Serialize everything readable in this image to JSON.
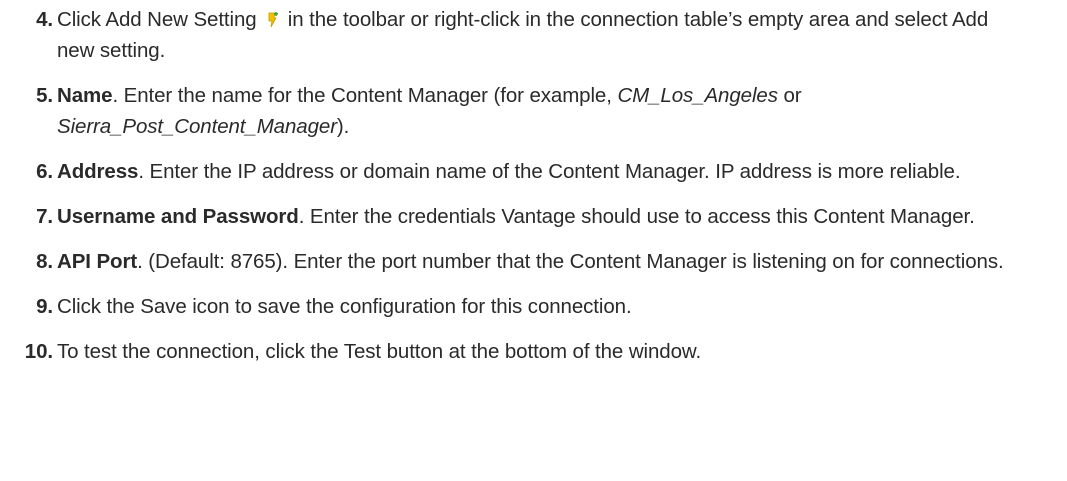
{
  "steps": [
    {
      "number": "4.",
      "text_before": "Click Add New Setting",
      "icon": "add-new-setting-icon",
      "text_after": "in the toolbar or right-click in the connection table’s empty area and select Add new setting."
    },
    {
      "number": "5.",
      "term": "Name",
      "text": ". Enter the name for the Content Manager (for example, ",
      "example_1": "CM_Los_Angeles",
      "joiner": " or ",
      "example_2": "Sierra_Post_Content_Manager",
      "text_end": ")."
    },
    {
      "number": "6.",
      "term": "Address",
      "text": ". Enter the IP address or domain name of the Content Manager. IP address is more reliable."
    },
    {
      "number": "7.",
      "term": "Username and Password",
      "text": ". Enter the credentials Vantage should use to access this Content Manager."
    },
    {
      "number": "8.",
      "term": "API Port",
      "text": ". (Default: 8765). Enter the port number that the Content Manager is listening on for connections."
    },
    {
      "number": "9.",
      "text": "Click the Save icon to save the configuration for this connection."
    },
    {
      "number": "10.",
      "text": "To test the connection, click the Test button at the bottom of the window."
    }
  ],
  "colors": {
    "text": "#2a2a2a",
    "icon_yellow": "#f2c200",
    "icon_green": "#3aa63a"
  }
}
